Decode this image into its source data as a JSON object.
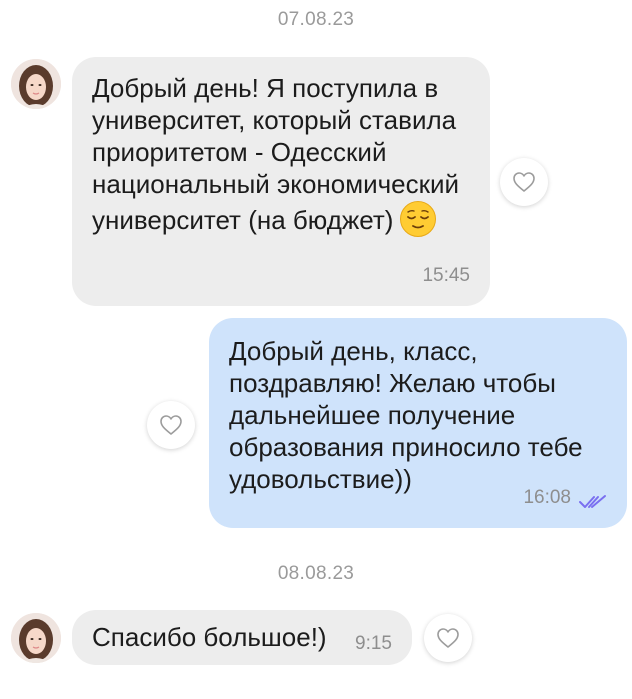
{
  "date_separators": [
    "07.08.23",
    "08.08.23"
  ],
  "messages": [
    {
      "direction": "incoming",
      "text": "Добрый день! Я поступила в университет, который ставила приоритетом - Одесский национальный экономический университет (на бюджет)",
      "emoji": "relieved-face",
      "time": "15:45"
    },
    {
      "direction": "outgoing",
      "text": "Добрый день, класс, поздравляю! Желаю чтобы дальнейшее получение образования приносило тебе удовольствие))",
      "time": "16:08",
      "status": "read"
    },
    {
      "direction": "incoming",
      "text": "Спасибо большое!)",
      "time": "9:15"
    }
  ],
  "colors": {
    "incoming_bubble": "#ededed",
    "outgoing_bubble": "#cfe3fb",
    "read_ticks": "#7a6ff0",
    "meta_text": "#8e8e8e"
  },
  "icons": {
    "like": "heart-outline-icon",
    "read_status": "double-check-icon"
  }
}
